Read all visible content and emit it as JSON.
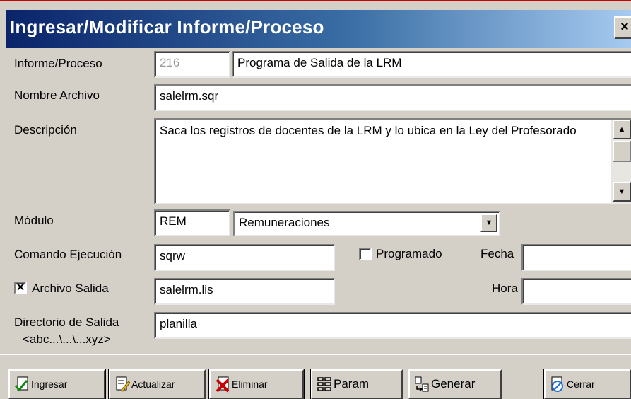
{
  "window": {
    "title": "Ingresar/Modificar Informe/Proceso",
    "close_label": "×"
  },
  "form": {
    "informe": {
      "label": "Informe/Proceso",
      "code": "216",
      "name": "Programa de Salida de la LRM"
    },
    "archivo": {
      "label": "Nombre Archivo",
      "value": "salelrm.sqr"
    },
    "descripcion": {
      "label": "Descripción",
      "value": "Saca los registros de docentes de la LRM y lo ubica en la Ley del Profesorado"
    },
    "modulo": {
      "label": "Módulo",
      "code": "REM",
      "selected": "Remuneraciones"
    },
    "comando": {
      "label": "Comando Ejecución",
      "value": "sqrw"
    },
    "programado": {
      "label": "Programado",
      "checked": false
    },
    "fecha": {
      "label": "Fecha",
      "value": ""
    },
    "archivo_salida": {
      "label": "Archivo Salida",
      "checked": true,
      "value": "salelrm.lis"
    },
    "hora": {
      "label": "Hora",
      "value": ""
    },
    "directorio": {
      "label_line1": "Directorio de Salida",
      "label_line2": "<abc...\\...\\...xyz>",
      "value": "planilla"
    }
  },
  "toolbar": {
    "ingresar": "Ingresar",
    "actualizar": "Actualizar",
    "eliminar": "Eliminar",
    "param": "Param",
    "generar": "Generar",
    "cerrar": "Cerrar"
  },
  "colors": {
    "title_gradient_start": "#0a246a",
    "title_gradient_end": "#a6caf0",
    "face": "#d4d0c8"
  },
  "icons": {
    "ingresar": "check-doc-icon",
    "actualizar": "edit-doc-icon",
    "eliminar": "delete-doc-icon",
    "param": "list-icon",
    "generar": "generate-icon",
    "cerrar": "close-doc-icon"
  }
}
